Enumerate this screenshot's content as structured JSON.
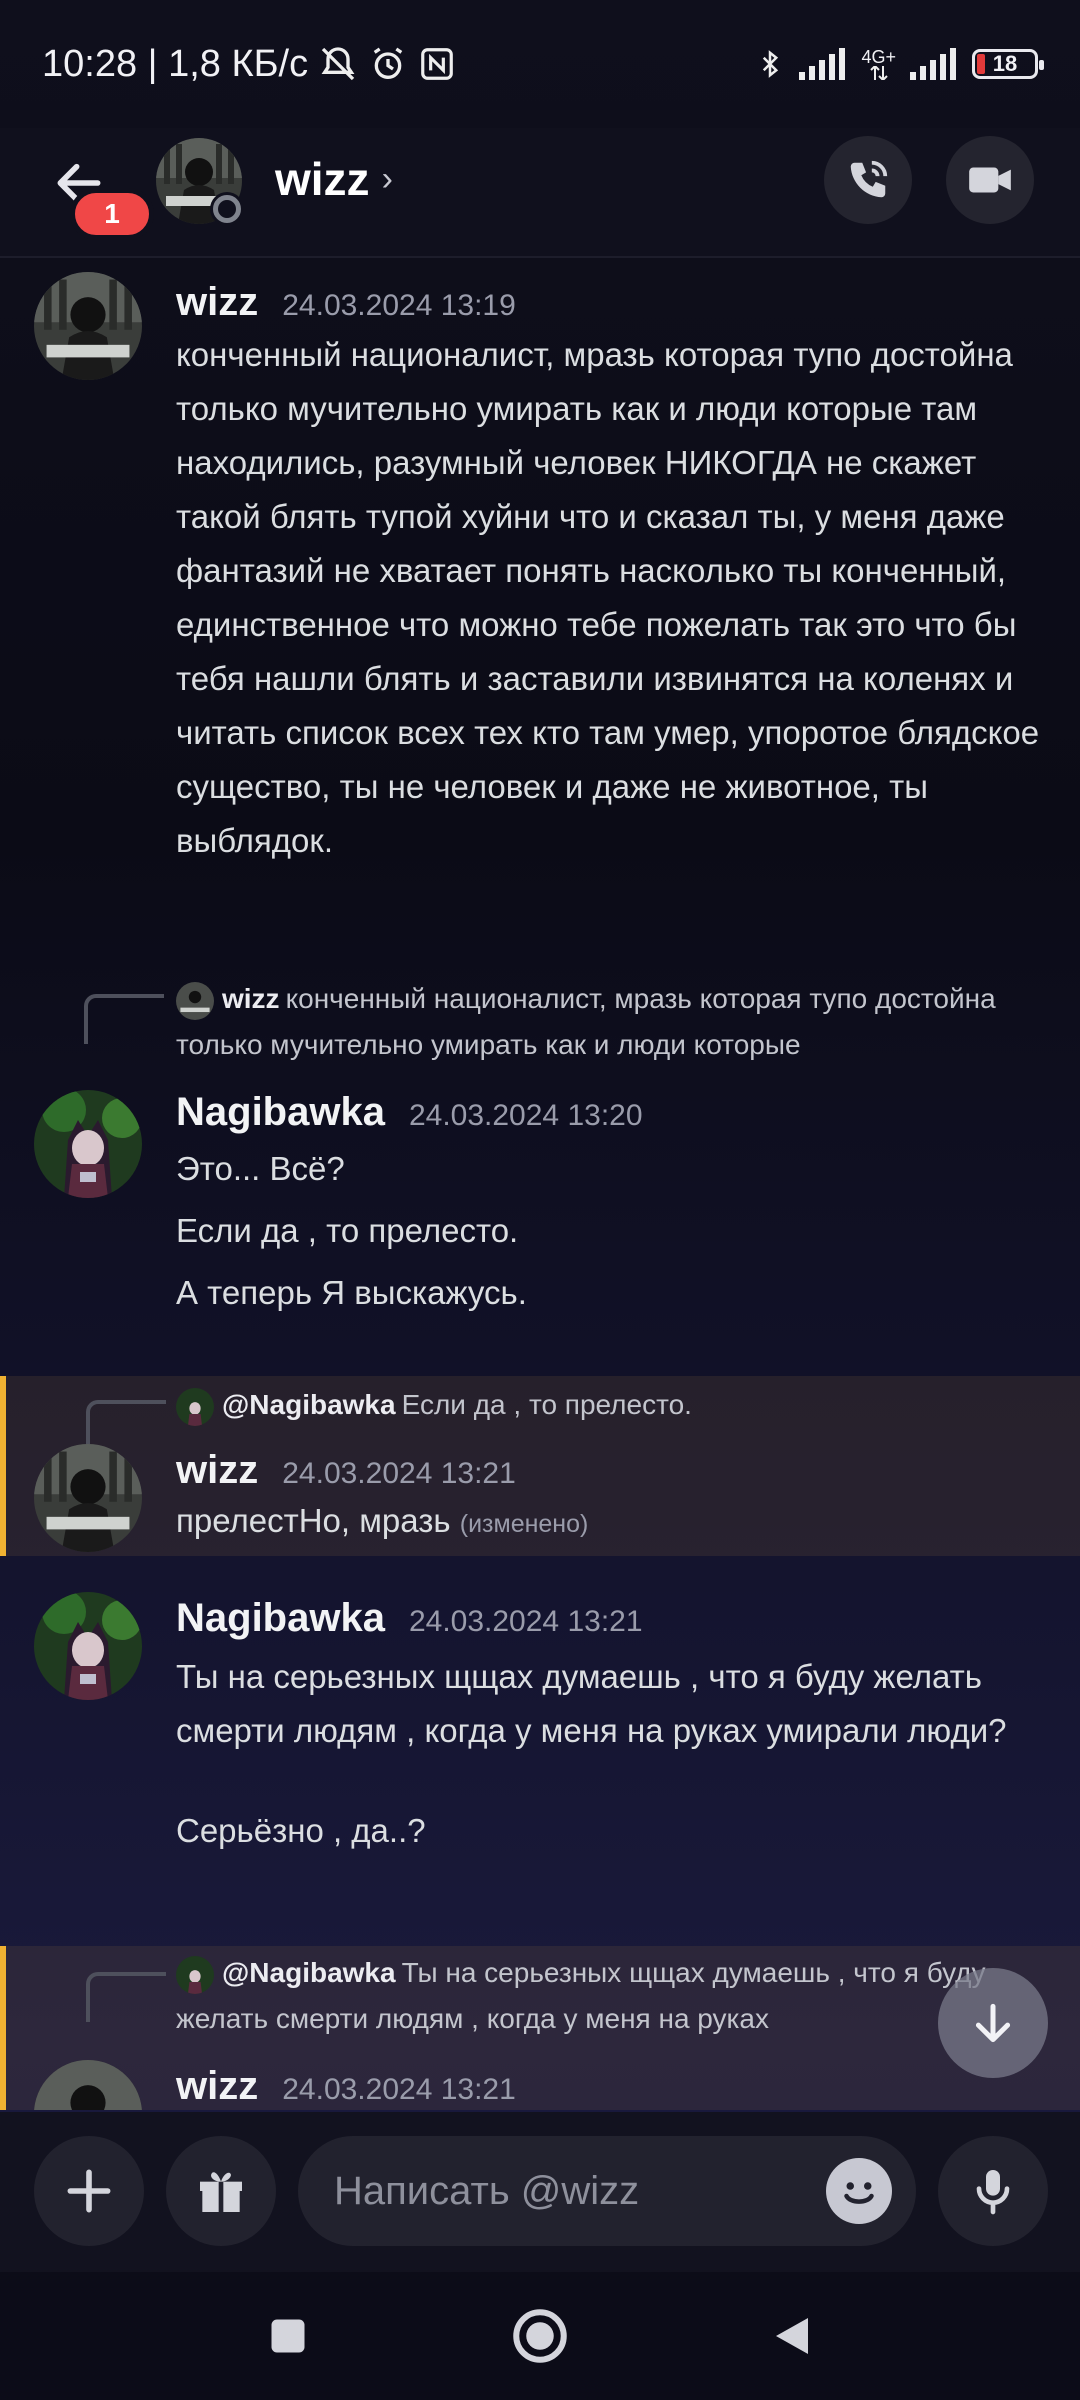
{
  "status_bar": {
    "time_speed": "10:28 | 1,8 КБ/с",
    "network": "4G+",
    "battery": "18"
  },
  "header": {
    "unread_badge": "1",
    "contact_name": "wizz",
    "chevron": "›"
  },
  "messages": [
    {
      "author": "wizz",
      "timestamp": "24.03.2024 13:19",
      "text": "конченный националист, мразь которая тупо достойна только мучительно умирать как и люди которые там находились, разумный человек НИКОГДА не скажет такой блять тупой хуйни что и сказал ты, у меня даже фантазий не хватает понять насколько ты конченный, единственное что можно тебе пожелать так это что бы тебя нашли блять и заставили извинятся на коленях и читать список всех тех кто там умер, упоротое блядское существо, ты не человек и даже не животное, ты выблядок."
    },
    {
      "reply": {
        "author": "wizz",
        "text": "конченный националист, мразь которая тупо достойна только мучительно умирать как и люди которые"
      },
      "author": "Nagibawka",
      "timestamp": "24.03.2024 13:20",
      "lines": [
        "Это... Всё?",
        "Если да , то прелесто.",
        "А теперь Я выскажусь."
      ]
    },
    {
      "reply": {
        "author": "@Nagibawka",
        "text": "Если да , то прелесто."
      },
      "author": "wizz",
      "timestamp": "24.03.2024 13:21",
      "text": "прелестНо, мразь",
      "edited": "(изменено)"
    },
    {
      "author": "Nagibawka",
      "timestamp": "24.03.2024 13:21",
      "text": "Ты на серьезных щщах думаешь , что я буду желать смерти людям , когда у меня на руках умирали люди?",
      "line2": "Серьёзно , да..?"
    },
    {
      "reply": {
        "author": "@Nagibawka",
        "text": "Ты на серьезных щщах думаешь , что я буду желать смерти людям , когда у меня на руках"
      },
      "author": "wizz",
      "timestamp": "24.03.2024 13:21"
    }
  ],
  "composer": {
    "placeholder": "Написать @wizz"
  },
  "colors": {
    "accent_highlight": "#f0b232",
    "badge_red": "#f04747",
    "background": "#0f0f1c"
  },
  "icons": [
    "back-arrow-icon",
    "phone-call-icon",
    "video-camera-icon",
    "plus-icon",
    "gift-icon",
    "emoji-icon",
    "microphone-icon",
    "arrow-down-icon",
    "square-icon",
    "circle-home-icon",
    "triangle-back-icon"
  ]
}
